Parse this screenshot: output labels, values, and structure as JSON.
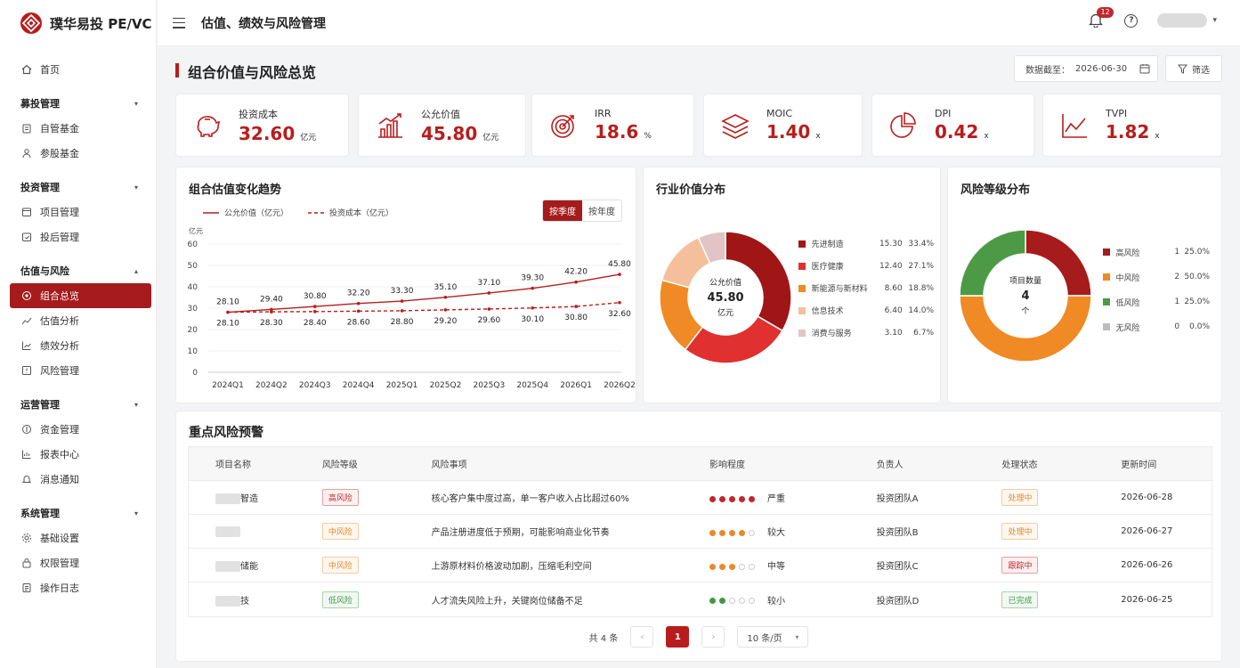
{
  "app": {
    "brand": "璞华易投 PE/VC",
    "page_header": "估值、绩效与风险管理"
  },
  "topbar": {
    "notification_count": "12",
    "help_glyph": "?"
  },
  "sidebar": {
    "home": "首页",
    "groups": [
      {
        "title": "募投管理",
        "items": [
          "自管基金",
          "参股基金"
        ]
      },
      {
        "title": "投资管理",
        "items": [
          "项目管理",
          "投后管理"
        ]
      },
      {
        "title": "估值与风险",
        "items": [
          "组合总览",
          "估值分析",
          "绩效分析",
          "风险管理"
        ]
      },
      {
        "title": "运营管理",
        "items": [
          "资金管理",
          "报表中心",
          "消息通知"
        ]
      },
      {
        "title": "系统管理",
        "items": [
          "基础设置",
          "权限管理",
          "操作日志"
        ]
      }
    ]
  },
  "main": {
    "title": "组合价值与风险总览",
    "date_label": "数据截至：",
    "date_value": "2026-06-30",
    "filter_label": "筛选"
  },
  "kpis": [
    {
      "label": "投资成本",
      "value": "32.60",
      "unit": "亿元",
      "icon": "piggy-bank-icon"
    },
    {
      "label": "公允价值",
      "value": "45.80",
      "unit": "亿元",
      "icon": "bar-growth-icon"
    },
    {
      "label": "IRR",
      "value": "18.6",
      "unit": "%",
      "icon": "target-icon"
    },
    {
      "label": "MOIC",
      "value": "1.40",
      "unit": "x",
      "icon": "layers-icon"
    },
    {
      "label": "DPI",
      "value": "0.42",
      "unit": "x",
      "icon": "pie-icon"
    },
    {
      "label": "TVPI",
      "value": "1.82",
      "unit": "x",
      "icon": "line-trend-icon"
    }
  ],
  "trend": {
    "title": "组合估值变化趋势",
    "toggle": [
      "按季度",
      "按年度"
    ],
    "legend": [
      "公允价值（亿元）",
      "投资成本（亿元）"
    ]
  },
  "industry": {
    "title": "行业价值分布",
    "center": [
      "公允价值",
      "45.80",
      "亿元"
    ]
  },
  "risk": {
    "title": "风险等级分布",
    "center": [
      "项目数量",
      "4",
      "个"
    ]
  },
  "table": {
    "title": "重点风险预警",
    "headers": [
      "项目名称",
      "风险等级",
      "风险事项",
      "影响程度",
      "负责人",
      "处理状态",
      "更新时间"
    ],
    "rows": [
      {
        "name": "智造",
        "level": "高风险",
        "issue": "核心客户集中度过高，单一客户收入占比超过60%",
        "impact": "严重",
        "dots": 5,
        "owner": "投资团队A",
        "status": "处理中",
        "date": "2026-06-28"
      },
      {
        "name": "",
        "level": "中风险",
        "issue": "产品注册进度低于预期，可能影响商业化节奏",
        "impact": "较大",
        "dots": 4,
        "owner": "投资团队B",
        "status": "处理中",
        "date": "2026-06-27"
      },
      {
        "name": "储能",
        "level": "中风险",
        "issue": "上游原材料价格波动加剧，压缩毛利空间",
        "impact": "中等",
        "dots": 3,
        "owner": "投资团队C",
        "status": "跟踪中",
        "date": "2026-06-26"
      },
      {
        "name": "技",
        "level": "低风险",
        "issue": "人才流失风险上升，关键岗位储备不足",
        "impact": "较小",
        "dots": 2,
        "owner": "投资团队D",
        "status": "已完成",
        "date": "2026-06-25"
      }
    ],
    "pager": {
      "total": "共 4 条",
      "current": "1",
      "page_size": "10 条/页"
    }
  },
  "colors": {
    "accent": "#b81d1d",
    "level": {
      "高风险": "#c0282d",
      "中风险": "#e8892a",
      "低风险": "#3e9a45"
    },
    "status": {
      "处理中": "#e8892a",
      "跟踪中": "#c0282d",
      "已完成": "#3e9a45"
    }
  },
  "chart_data": [
    {
      "type": "line",
      "title": "组合估值变化趋势",
      "ylabel": "亿元",
      "ylim": [
        0,
        60
      ],
      "yticks": [
        0,
        10,
        20,
        30,
        40,
        50,
        60
      ],
      "x": [
        "2024Q1",
        "2024Q2",
        "2024Q3",
        "2024Q4",
        "2025Q1",
        "2025Q2",
        "2025Q3",
        "2025Q4",
        "2026Q1",
        "2026Q2"
      ],
      "series": [
        {
          "name": "公允价值（亿元）",
          "values": [
            28.1,
            29.4,
            30.8,
            32.2,
            33.3,
            35.1,
            37.1,
            39.3,
            42.2,
            45.8
          ],
          "labels": [
            "28.10",
            "29.40",
            "30.80",
            "32.20",
            "33.30",
            "35.10",
            "37.10",
            "39.30",
            "42.20",
            "45.80"
          ],
          "color": "#b81d1d",
          "style": "solid"
        },
        {
          "name": "投资成本（亿元）",
          "values": [
            28.1,
            28.3,
            28.4,
            28.6,
            28.8,
            29.2,
            29.6,
            30.1,
            30.8,
            32.6
          ],
          "labels": [
            "28.10",
            "28.30",
            "28.40",
            "28.60",
            "28.80",
            "29.20",
            "29.60",
            "30.10",
            "30.80",
            "32.60"
          ],
          "color": "#b81d1d",
          "style": "dashed"
        }
      ],
      "grid": true,
      "legend": "top-left"
    },
    {
      "type": "pie",
      "title": "行业价值分布",
      "categories": [
        "先进制造",
        "医疗健康",
        "新能源与新材料",
        "信息技术",
        "消费与服务"
      ],
      "values": [
        15.3,
        12.4,
        8.6,
        6.4,
        3.1
      ],
      "value_labels": [
        "15.30",
        "12.40",
        "8.60",
        "6.40",
        "3.10"
      ],
      "percent_labels": [
        "33.4%",
        "27.1%",
        "18.8%",
        "14.0%",
        "6.7%"
      ],
      "colors": [
        "#a01515",
        "#e03030",
        "#f08a24",
        "#f6bf9c",
        "#e2c4c4"
      ],
      "legend": "right"
    },
    {
      "type": "pie",
      "title": "风险等级分布",
      "categories": [
        "高风险",
        "中风险",
        "低风险",
        "无风险"
      ],
      "values": [
        1,
        2,
        1,
        0
      ],
      "value_labels": [
        "1",
        "2",
        "1",
        "0"
      ],
      "percent_labels": [
        "25.0%",
        "50.0%",
        "25.0%",
        "0.0%"
      ],
      "colors": [
        "#a61b1b",
        "#f08a24",
        "#4c9a45",
        "#bdbdbd"
      ],
      "legend": "right"
    }
  ]
}
